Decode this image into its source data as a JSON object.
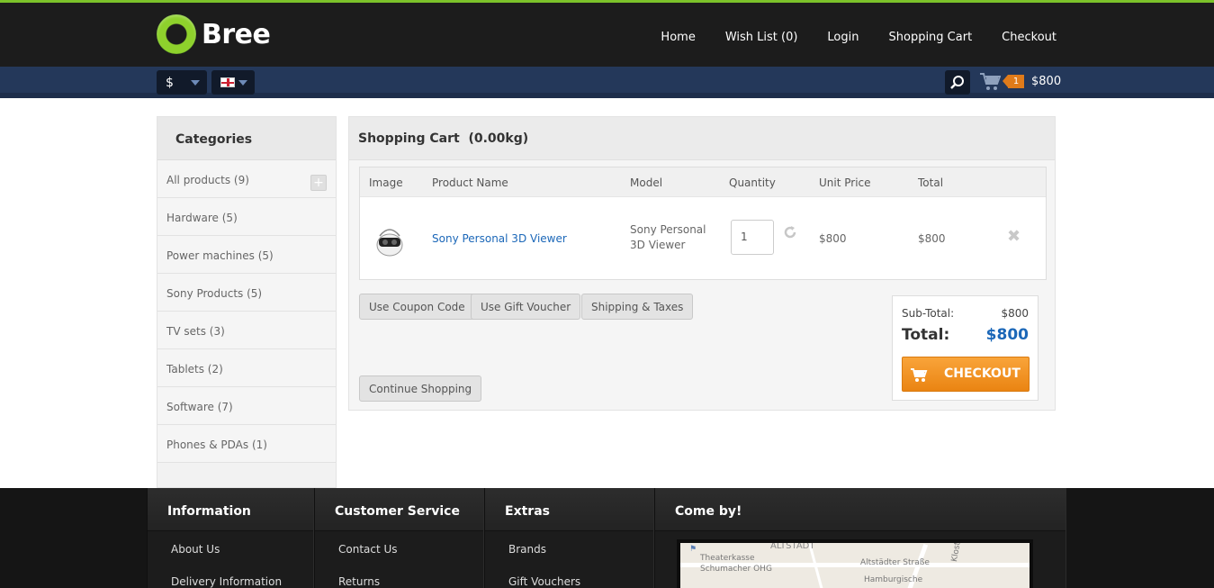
{
  "brand": {
    "name": "Bree"
  },
  "nav": {
    "home": "Home",
    "wishlist": "Wish List (0)",
    "login": "Login",
    "cart": "Shopping Cart",
    "checkout": "Checkout"
  },
  "toolbar": {
    "currency": "$",
    "cart_count": "1",
    "cart_total": "$800"
  },
  "categories": {
    "title": "Categories",
    "items": [
      {
        "label": "All products (9)"
      },
      {
        "label": "Hardware (5)"
      },
      {
        "label": "Power machines (5)"
      },
      {
        "label": "Sony Products (5)"
      },
      {
        "label": "TV sets (3)"
      },
      {
        "label": "Tablets (2)"
      },
      {
        "label": "Software (7)"
      },
      {
        "label": "Phones & PDAs (1)"
      }
    ]
  },
  "cart": {
    "title": "Shopping Cart  (0.00kg)",
    "headers": {
      "image": "Image",
      "name": "Product Name",
      "model": "Model",
      "quantity": "Quantity",
      "unit_price": "Unit Price",
      "total": "Total"
    },
    "row": {
      "name": "Sony Personal 3D Viewer",
      "model_line1": "Sony Personal",
      "model_line2": "3D Viewer",
      "quantity": "1",
      "unit_price": "$800",
      "total": "$800"
    },
    "buttons": {
      "coupon": "Use Coupon Code",
      "voucher": "Use Gift Voucher",
      "shipping": "Shipping & Taxes",
      "continue": "Continue Shopping"
    },
    "totals": {
      "subtotal_label": "Sub-Total:",
      "subtotal_value": "$800",
      "total_label": "Total:",
      "total_value": "$800",
      "checkout": "CHECKOUT"
    }
  },
  "footer": {
    "information": {
      "title": "Information",
      "links": [
        "About Us",
        "Delivery Information"
      ]
    },
    "service": {
      "title": "Customer Service",
      "links": [
        "Contact Us",
        "Returns"
      ]
    },
    "extras": {
      "title": "Extras",
      "links": [
        "Brands",
        "Gift Vouchers"
      ]
    },
    "comeby": {
      "title": "Come by!",
      "map_labels": [
        "ALTSTADT",
        "Theaterkasse",
        "Schumacher OHG",
        "Altstädter Straße",
        "Hamburgische",
        "Klosterwall"
      ]
    }
  },
  "colors": {
    "accent_green": "#7cc22a",
    "link_blue": "#1b67b8",
    "checkout_orange": "#f29420",
    "subbar_blue": "#24385a"
  }
}
